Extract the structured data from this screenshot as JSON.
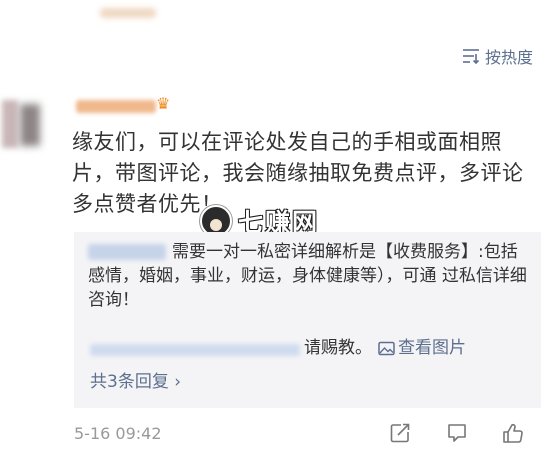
{
  "header": {
    "sort_label": "按热度",
    "sort_icon": "sort-lines-icon"
  },
  "comment": {
    "text": "缘友们，可以在评论处发自己的手相或面相照片，带图评论，我会随缘抽取免费点评，多评论多点赞者优先！",
    "vip_icon": "crown-icon",
    "timestamp": "5-16 09:42"
  },
  "watermark": {
    "text": "七赚网"
  },
  "replies": {
    "items": [
      {
        "text": "需要一对一私密详细解析是【收费服务】:包括感情，婚姻，事业，财运，身体健康等），可通  过私信详细咨询！"
      },
      {
        "text": "请赐教。",
        "link_label": "查看图片"
      }
    ],
    "more_label": "共3条回复 ›"
  },
  "actions": {
    "icons": [
      "share-icon",
      "comment-icon",
      "like-icon"
    ]
  },
  "colors": {
    "link": "#5d6f8f",
    "text": "#333333",
    "reply_bg": "#f4f4f6",
    "meta": "#999999"
  }
}
